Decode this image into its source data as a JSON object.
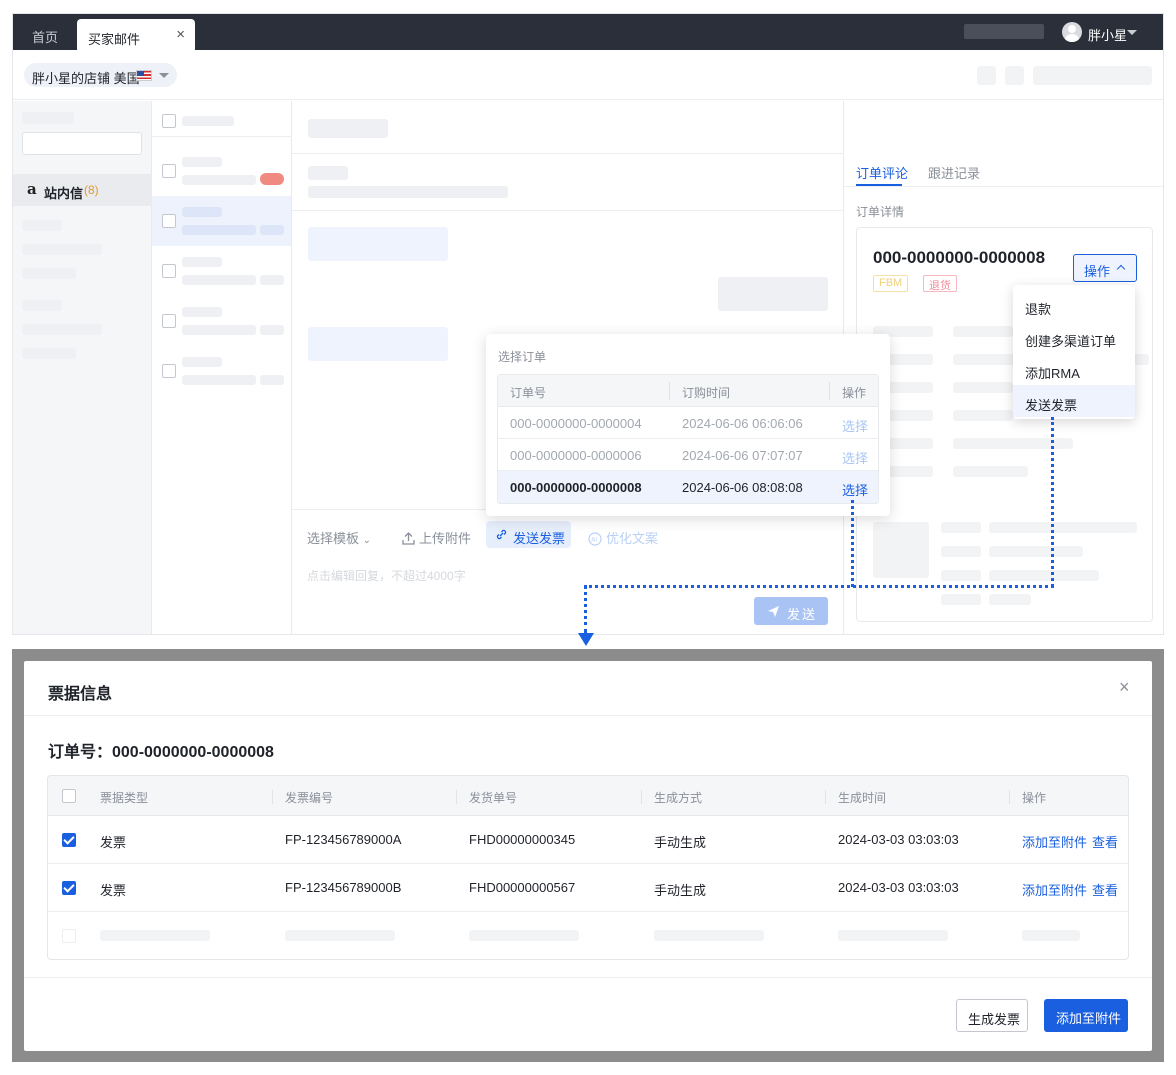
{
  "tabs": {
    "home": "首页",
    "active": "买家邮件",
    "close": "×"
  },
  "user": {
    "name": "胖小星"
  },
  "shop": {
    "label": "胖小星的店铺 美国"
  },
  "sidebar": {
    "amazon_glyph": "a",
    "label": "站内信",
    "count": "(8)"
  },
  "composer": {
    "template": "选择模板",
    "upload": "上传附件",
    "invoice": "发送发票",
    "optimize": "优化文案",
    "placeholder": "点击编辑回复，不超过4000字",
    "send": "发送"
  },
  "right_panel": {
    "tab_review": "订单评论",
    "tab_follow": "跟进记录",
    "detail_label": "订单详情",
    "order_no": "000-0000000-0000008",
    "tag_fbm": "FBM",
    "tag_return": "退货",
    "op_button": "操作"
  },
  "op_menu": [
    "退款",
    "创建多渠道订单",
    "添加RMA",
    "发送发票"
  ],
  "select_order": {
    "title": "选择订单",
    "headers": [
      "订单号",
      "订购时间",
      "操作"
    ],
    "rows": [
      {
        "order": "000-0000000-0000004",
        "time": "2024-06-06 06:06:06",
        "action": "选择"
      },
      {
        "order": "000-0000000-0000006",
        "time": "2024-06-06 07:07:07",
        "action": "选择"
      },
      {
        "order": "000-0000000-0000008",
        "time": "2024-06-06 08:08:08",
        "action": "选择"
      }
    ]
  },
  "modal": {
    "title": "票据信息",
    "close": "×",
    "order_label": "订单号：000-0000000-0000008",
    "headers": [
      "票据类型",
      "发票编号",
      "发货单号",
      "生成方式",
      "生成时间",
      "操作"
    ],
    "rows": [
      {
        "checked": true,
        "type": "发票",
        "invoice_no": "FP-123456789000A",
        "ship_no": "FHD00000000345",
        "method": "手动生成",
        "time": "2024-03-03 03:03:03",
        "action_add": "添加至附件",
        "action_view": "查看"
      },
      {
        "checked": true,
        "type": "发票",
        "invoice_no": "FP-123456789000B",
        "ship_no": "FHD00000000567",
        "method": "手动生成",
        "time": "2024-03-03 03:03:03",
        "action_add": "添加至附件",
        "action_view": "查看"
      }
    ],
    "btn_generate": "生成发票",
    "btn_add": "添加至附件"
  },
  "colors": {
    "primary": "#1a5fe0",
    "tabbar": "#2a2f3a",
    "overlay": "#8c8c8c",
    "count": "#e39a2b"
  }
}
